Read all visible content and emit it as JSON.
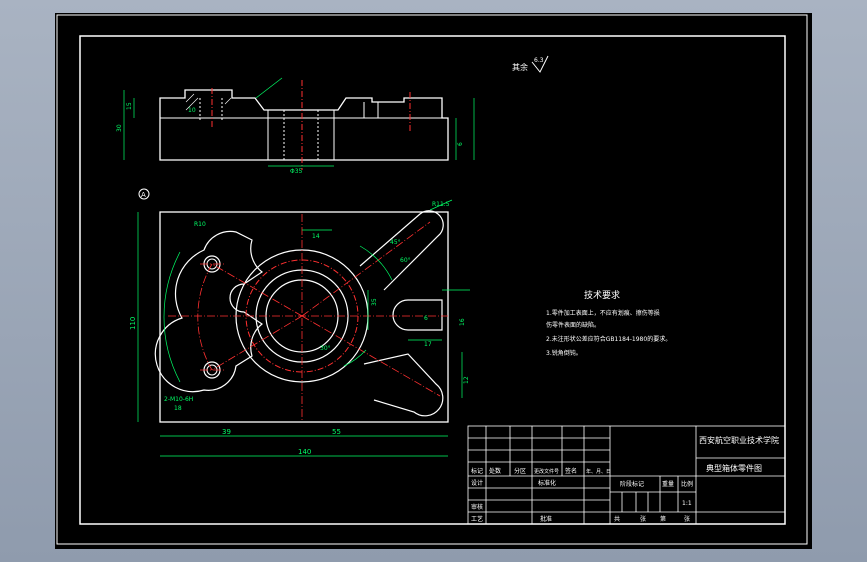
{
  "drawing": {
    "roughness_label": "其余",
    "roughness_value": "6.3",
    "tech_title": "技术要求",
    "tech_notes": [
      "1.零件加工表面上，不应有划痕、擦伤等损",
      "伤零件表面的缺陷。",
      "2.未注形状公差应符合GB1184-1980的要求。",
      "3.锐角倒钝。"
    ],
    "section_mark": "A",
    "dims": {
      "overall_width": "140",
      "height_left": "110",
      "offset_39": "39",
      "offset_55": "55",
      "d10": "R10",
      "r11": "R11.5",
      "d14": "14",
      "d35": "35",
      "d17": "17",
      "d16": "16",
      "d6": "6",
      "d12": "12",
      "angle_45": "45°",
      "angle_60": "60°",
      "angle_30": "30°",
      "holes": "2-M10-6H",
      "holes_depth": "18",
      "phi_hole": "Φ35",
      "top_d1": "15",
      "top_d2": "30",
      "top_d3": "10",
      "top_d4": "6"
    },
    "title_block": {
      "school": "西安航空职业技术学院",
      "part_name": "典型箱体零件图",
      "scale_value": "1:1",
      "row_labels": [
        "标记",
        "处数",
        "分区",
        "更改文件号",
        "签名",
        "年、月、日"
      ],
      "labels_design": "设计",
      "labels_standard": "标准化",
      "labels_review": "审核",
      "labels_process": "工艺",
      "labels_approve": "批准",
      "stage_label": "阶段标记",
      "weight_label": "重量",
      "scale_label": "比例",
      "sheet_total": "共",
      "sheet_unit": "张",
      "sheet_no": "第",
      "sheet_unit2": "张"
    }
  }
}
